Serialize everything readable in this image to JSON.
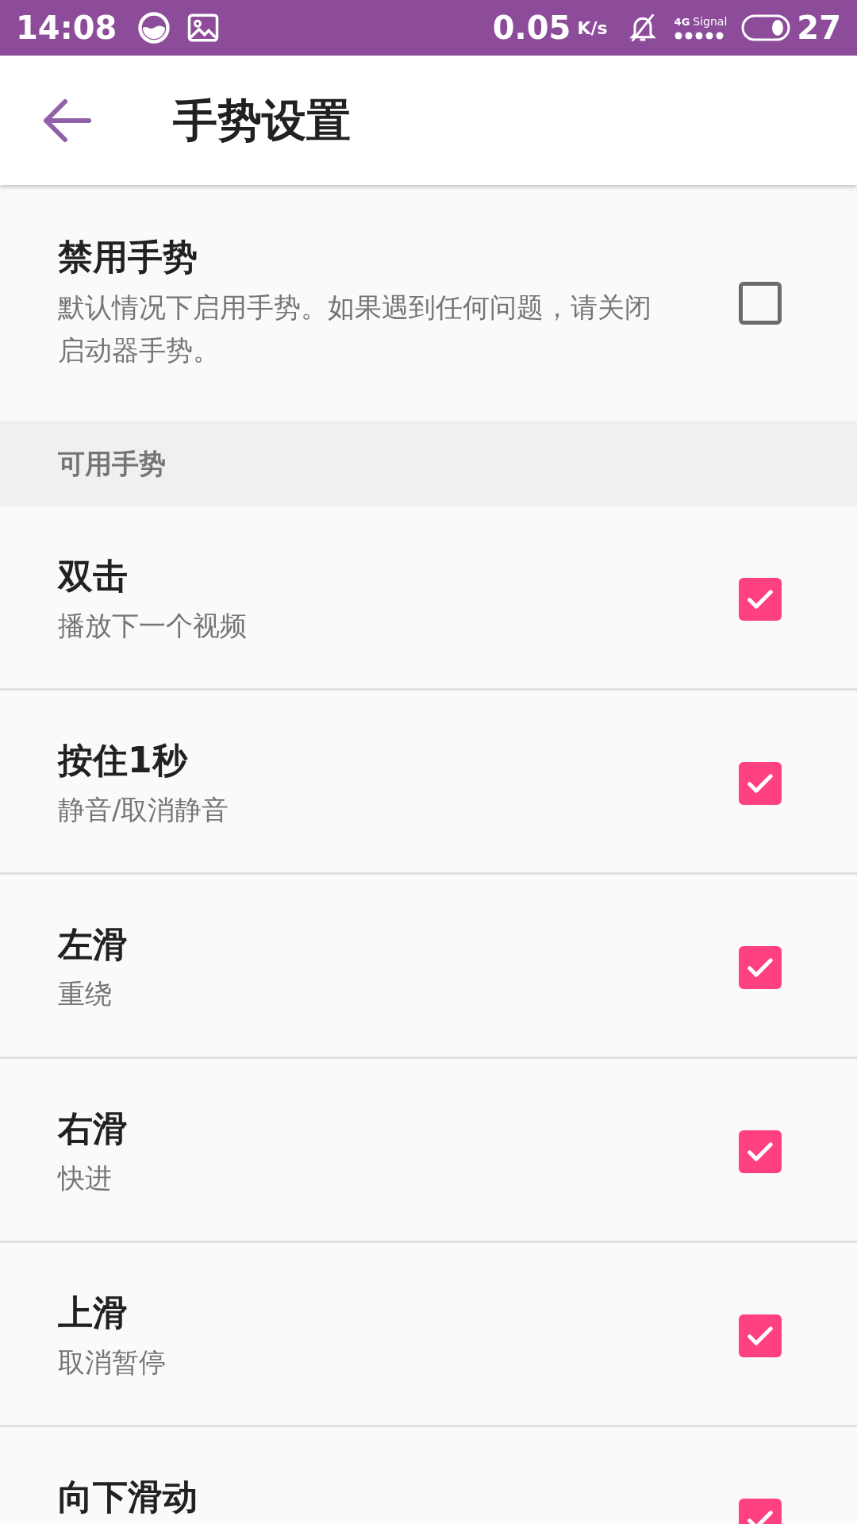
{
  "status_bar": {
    "time": "14:08",
    "speed": "0.05",
    "speed_unit": "K/s",
    "network": "4G",
    "signal_label": "Signal",
    "battery": "27"
  },
  "app_bar": {
    "title": "手势设置"
  },
  "master": {
    "title": "禁用手势",
    "description": "默认情况下启用手势。如果遇到任何问题，请关闭启动器手势。",
    "checked": false
  },
  "section": {
    "title": "可用手势"
  },
  "gestures": [
    {
      "title": "双击",
      "description": "播放下一个视频",
      "checked": true
    },
    {
      "title": "按住1秒",
      "description": "静音/取消静音",
      "checked": true
    },
    {
      "title": "左滑",
      "description": "重绕",
      "checked": true
    },
    {
      "title": "右滑",
      "description": "快进",
      "checked": true
    },
    {
      "title": "上滑",
      "description": "取消暂停",
      "checked": true
    },
    {
      "title": "向下滑动",
      "checked": true
    }
  ]
}
